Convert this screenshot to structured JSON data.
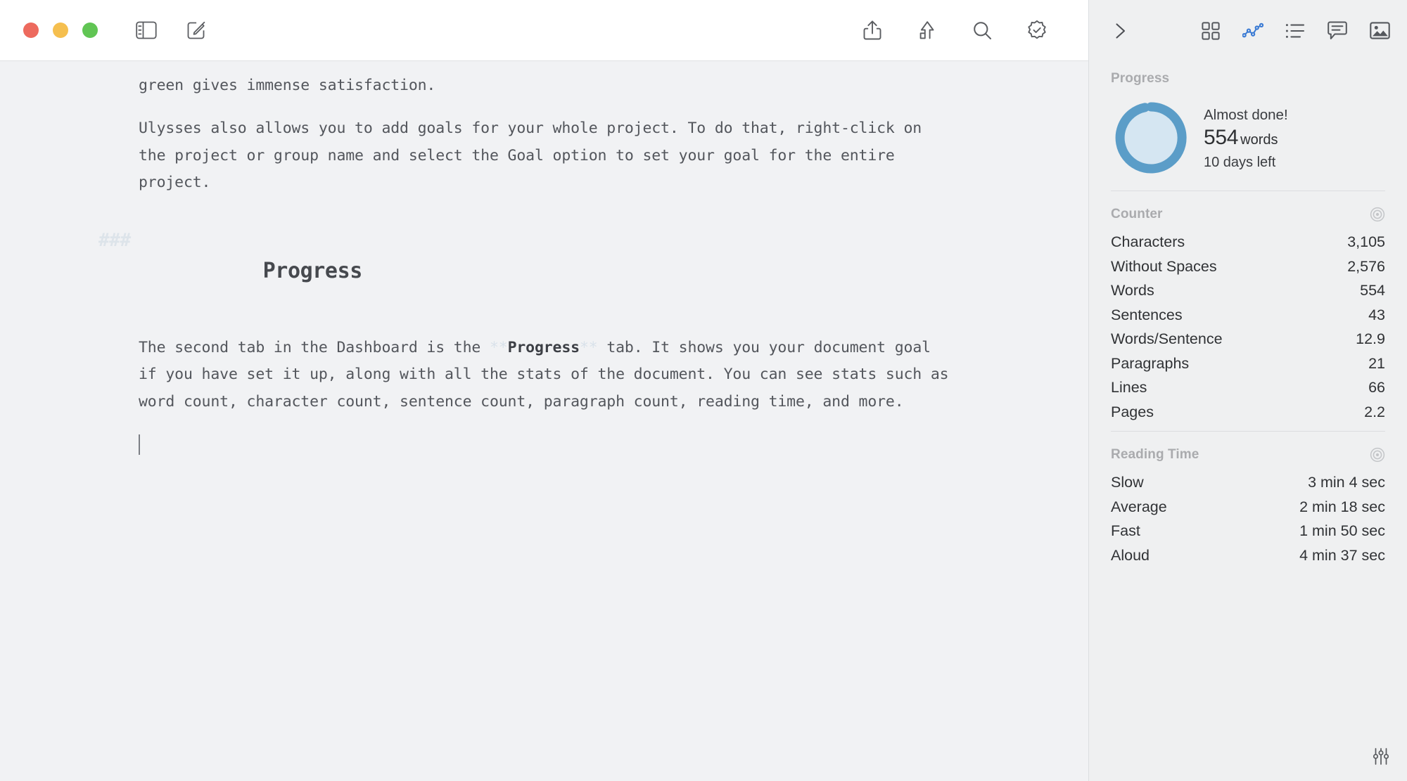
{
  "window": {
    "traffic_lights": [
      {
        "name": "close",
        "color": "#ed6a5e"
      },
      {
        "name": "minimize",
        "color": "#f5bf4f"
      },
      {
        "name": "zoom",
        "color": "#61c554"
      }
    ]
  },
  "toolbar": {
    "left_icons": [
      {
        "name": "sidebar-toggle-icon",
        "label": "Toggle Sidebar"
      },
      {
        "name": "compose-icon",
        "label": "New Sheet"
      }
    ],
    "right_icons": [
      {
        "name": "share-icon",
        "label": "Share"
      },
      {
        "name": "export-icon",
        "label": "Export"
      },
      {
        "name": "search-icon",
        "label": "Search"
      },
      {
        "name": "checkmark-badge-icon",
        "label": "Revision Mode"
      }
    ]
  },
  "document": {
    "paragraph_1": "green gives immense satisfaction.",
    "paragraph_2": "Ulysses also allows you to add goals for your whole project. To do that, right-click on the project or group name and select the Goal option to set your goal for the entire project.",
    "heading_marks": "###",
    "heading": "Progress",
    "paragraph_3_part_1": "The second tab in the Dashboard is the ",
    "paragraph_3_mark_open": "**",
    "paragraph_3_bold": "Progress",
    "paragraph_3_mark_close": "**",
    "paragraph_3_part_2": " tab. It shows you your document goal if you have set it up, along with all the stats of the document. You can see stats such as word count, character count, sentence count, paragraph count, reading time, and more."
  },
  "panel": {
    "collapse_icon": "chevron-right-icon",
    "tabs": [
      {
        "name": "tab-overview",
        "icon": "grid-icon",
        "label": "Overview",
        "active": false
      },
      {
        "name": "tab-progress",
        "icon": "line-chart-icon",
        "label": "Progress",
        "active": true
      },
      {
        "name": "tab-outline",
        "icon": "list-icon",
        "label": "Outline",
        "active": false
      },
      {
        "name": "tab-comments",
        "icon": "comment-icon",
        "label": "Comments",
        "active": false
      },
      {
        "name": "tab-images",
        "icon": "image-icon",
        "label": "Images",
        "active": false
      }
    ],
    "accent_color": "#3b7bd4",
    "progress": {
      "title": "Progress",
      "status": "Almost done!",
      "count": "554",
      "count_unit": "words",
      "days_left": "10 days left",
      "ring_percent": 95,
      "ring_color": "#5b9dc8",
      "ring_fill_color": "#d5e6f2"
    },
    "counter": {
      "title": "Counter",
      "icon": "target-icon",
      "rows": [
        {
          "label": "Characters",
          "value": "3,105"
        },
        {
          "label": "Without Spaces",
          "value": "2,576"
        },
        {
          "label": "Words",
          "value": "554"
        },
        {
          "label": "Sentences",
          "value": "43"
        },
        {
          "label": "Words/Sentence",
          "value": "12.9"
        },
        {
          "label": "Paragraphs",
          "value": "21"
        },
        {
          "label": "Lines",
          "value": "66"
        },
        {
          "label": "Pages",
          "value": "2.2"
        }
      ]
    },
    "reading_time": {
      "title": "Reading Time",
      "icon": "target-icon",
      "rows": [
        {
          "label": "Slow",
          "value": "3 min 4 sec"
        },
        {
          "label": "Average",
          "value": "2 min 18 sec"
        },
        {
          "label": "Fast",
          "value": "1 min 50 sec"
        },
        {
          "label": "Aloud",
          "value": "4 min 37 sec"
        }
      ]
    },
    "footer_icon": "sliders-icon"
  }
}
